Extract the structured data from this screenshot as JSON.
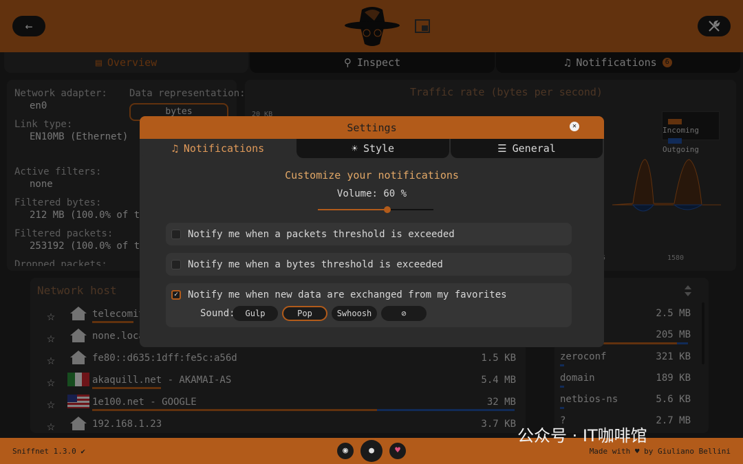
{
  "header": {
    "back_icon": "arrow-left-icon",
    "settings_icon": "wrench-icon"
  },
  "tabs": [
    {
      "label": "Overview",
      "icon": "chart-icon"
    },
    {
      "label": "Inspect",
      "icon": "magnifier-icon"
    },
    {
      "label": "Notifications",
      "icon": "bell-icon",
      "badge": "6"
    }
  ],
  "overview": {
    "network_adapter_label": "Network adapter:",
    "network_adapter_value": "en0",
    "link_type_label": "Link type:",
    "link_type_value": "EN10MB (Ethernet)",
    "data_representation_label": "Data representation:",
    "data_representation_value": "bytes",
    "active_filters_label": "Active filters:",
    "active_filters_value": "none",
    "filtered_bytes_label": "Filtered bytes:",
    "filtered_bytes_value": "212 MB (100.0% of the t",
    "filtered_packets_label": "Filtered packets:",
    "filtered_packets_value": "253192 (100.0% of the t",
    "dropped_packets_label": "Dropped packets:"
  },
  "chart": {
    "title": "Traffic rate (bytes per second)",
    "y_tick": "20 KB",
    "x_ticks": [
      "5",
      "1580"
    ],
    "legend": [
      {
        "name": "Incoming",
        "color": "#b25b1a"
      },
      {
        "name": "Outgoing",
        "color": "#1f4fa0"
      }
    ]
  },
  "hosts": {
    "title": "Network host",
    "rows": [
      {
        "name": "telecomita",
        "size": "",
        "icon": "house-icon"
      },
      {
        "name": "none.local",
        "size": "",
        "icon": "house-icon"
      },
      {
        "name": "fe80::d635:1dff:fe5c:a56d",
        "size": "1.5 KB",
        "icon": "house-icon"
      },
      {
        "name": "akaquill.net - AKAMAI-AS",
        "size": "5.4 MB",
        "icon": "italy-flag-icon"
      },
      {
        "name": "1e100.net - GOOGLE",
        "size": "32 MB",
        "icon": "us-flag-icon"
      },
      {
        "name": "192.168.1.23",
        "size": "3.7 KB",
        "icon": "house-icon"
      }
    ]
  },
  "services": {
    "rows": [
      {
        "name": "",
        "size": "2.5 MB"
      },
      {
        "name": "",
        "size": "205 MB"
      },
      {
        "name": "zeroconf",
        "size": "321 KB"
      },
      {
        "name": "domain",
        "size": "189 KB"
      },
      {
        "name": "netbios-ns",
        "size": "5.6 KB"
      },
      {
        "name": "?",
        "size": "2.7 MB"
      }
    ]
  },
  "settings": {
    "title": "Settings",
    "tabs": [
      {
        "label": "Notifications",
        "icon": "bell-icon"
      },
      {
        "label": "Style",
        "icon": "sun-icon"
      },
      {
        "label": "General",
        "icon": "list-icon"
      }
    ],
    "subtitle": "Customize your notifications",
    "volume_label": "Volume: 60 %",
    "volume_value": 60,
    "options": [
      {
        "label": "Notify me when a packets threshold is exceeded",
        "checked": false
      },
      {
        "label": "Notify me when a bytes threshold is exceeded",
        "checked": false
      },
      {
        "label": "Notify me when new data are exchanged from my favorites",
        "checked": true
      }
    ],
    "sound_label": "Sound:",
    "sounds": [
      "Gulp",
      "Pop",
      "Swhoosh",
      "⊘"
    ],
    "selected_sound": "Pop"
  },
  "footer": {
    "version": "Sniffnet 1.3.0 ✔",
    "credits": "Made with ♥ by Giuliano Bellini",
    "watermark": "公众号 · IT咖啡馆"
  },
  "colors": {
    "accent": "#b25b1a",
    "incoming": "#b25b1a",
    "outgoing": "#1f4fa0"
  }
}
